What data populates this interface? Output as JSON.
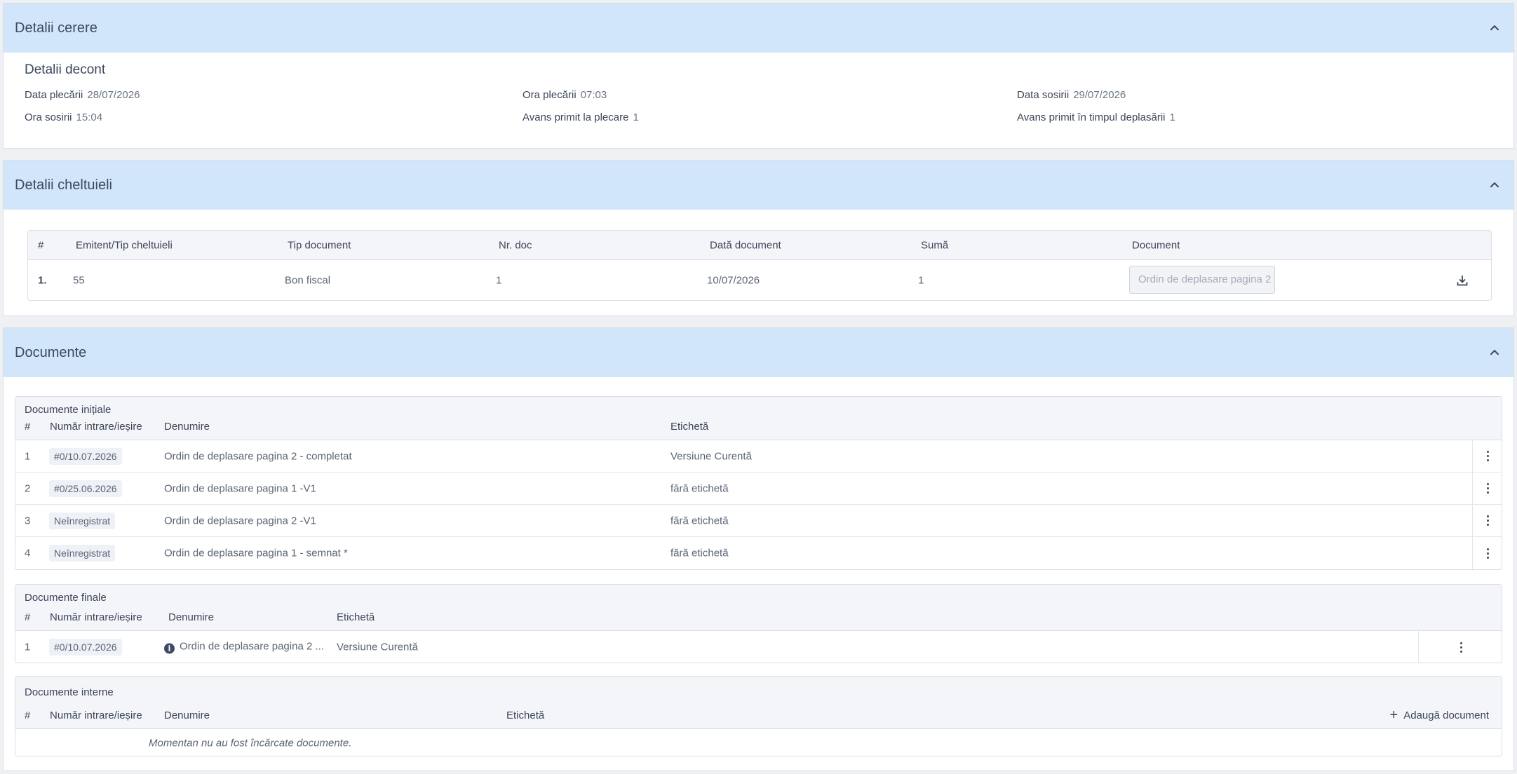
{
  "request_panel": {
    "title": "Detalii cerere",
    "subtitle": "Detalii decont",
    "fields": {
      "departure_date_label": "Data plecării",
      "departure_date": "28/07/2026",
      "departure_time_label": "Ora plecării",
      "departure_time": "07:03",
      "arrival_date_label": "Data sosirii",
      "arrival_date": "29/07/2026",
      "arrival_time_label": "Ora sosirii",
      "arrival_time": "15:04",
      "advance_departure_label": "Avans primit la plecare",
      "advance_departure": "1",
      "advance_during_label": "Avans primit în timpul deplasării",
      "advance_during": "1"
    }
  },
  "expenses_panel": {
    "title": "Detalii cheltuieli",
    "columns": [
      "#",
      "Emitent/Tip cheltuieli",
      "Tip document",
      "Nr. doc",
      "Dată document",
      "Sumă",
      "Document"
    ],
    "rows": [
      {
        "index": "1.",
        "issuer": "55",
        "doc_type": "Bon fiscal",
        "doc_no": "1",
        "doc_date": "10/07/2026",
        "amount": "1",
        "document": "Ordin de deplasare pagina 2"
      }
    ]
  },
  "documents_panel": {
    "title": "Documente",
    "initial": {
      "label": "Documente inițiale",
      "col_index": "#",
      "col_number": "Număr intrare/ieșire",
      "col_name": "Denumire",
      "col_tag": "Etichetă",
      "rows": [
        {
          "index": "1",
          "number": "#0/10.07.2026",
          "name": "Ordin de deplasare pagina 2 - completat",
          "tag": "Versiune Curentă"
        },
        {
          "index": "2",
          "number": "#0/25.06.2026",
          "name": "Ordin de deplasare pagina 1 -V1",
          "tag": "fără etichetă"
        },
        {
          "index": "3",
          "number": "Neînregistrat",
          "name": "Ordin de deplasare pagina 2 -V1",
          "tag": "fără etichetă"
        },
        {
          "index": "4",
          "number": "Neînregistrat",
          "name": "Ordin de deplasare pagina 1 - semnat *",
          "tag": "fără etichetă"
        }
      ]
    },
    "final": {
      "label": "Documente finale",
      "col_index": "#",
      "col_number": "Număr intrare/ieșire",
      "col_name": "Denumire",
      "col_tag": "Etichetă",
      "rows": [
        {
          "index": "1",
          "number": "#0/10.07.2026",
          "name": "Ordin de deplasare pagina 2 ...",
          "tag": "Versiune Curentă"
        }
      ]
    },
    "internal": {
      "label": "Documente interne",
      "col_index": "#",
      "col_number": "Număr intrare/ieșire",
      "col_name": "Denumire",
      "col_tag": "Etichetă",
      "add_label": "Adaugă document",
      "empty_message": "Momentan nu au fost încărcate documente."
    }
  },
  "colors": {
    "header_bg": "#d2e6fb",
    "table_header_bg": "#f3f5f9"
  }
}
